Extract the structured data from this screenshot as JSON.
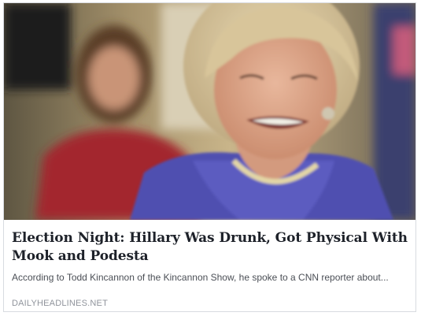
{
  "link_card": {
    "image_label": "article-thumbnail",
    "headline": "Election Night: Hillary Was Drunk, Got Physical With Mook and Podesta",
    "description": "According to Todd Kincannon of the Kincannon Show, he spoke to a CNN reporter about...",
    "source": "DAILYHEADLINES.NET"
  },
  "colors": {
    "headline": "#1d2129",
    "description": "#4b4f56",
    "source": "#90949c",
    "border": "#d8dbe0"
  }
}
